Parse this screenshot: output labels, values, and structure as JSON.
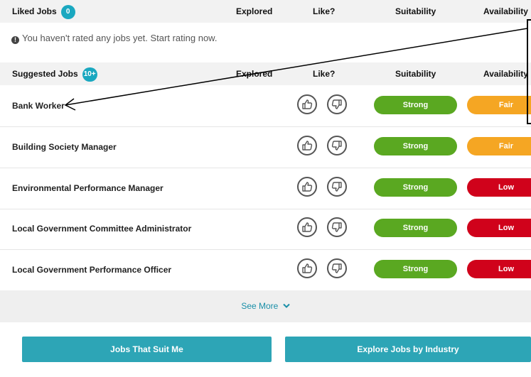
{
  "liked": {
    "title": "Liked Jobs",
    "count": "0",
    "col_explored": "Explored",
    "col_like": "Like?",
    "col_suitability": "Suitability",
    "col_availability": "Availability",
    "empty_message": "You haven't rated any jobs yet. Start rating now."
  },
  "suggested": {
    "title": "Suggested Jobs",
    "count": "10+",
    "col_explored": "Explored",
    "col_like": "Like?",
    "col_suitability": "Suitability",
    "col_availability": "Availability",
    "rows": [
      {
        "title": "Bank Worker",
        "suitability": "Strong",
        "availability": "Fair"
      },
      {
        "title": "Building Society Manager",
        "suitability": "Strong",
        "availability": "Fair"
      },
      {
        "title": "Environmental Performance Manager",
        "suitability": "Strong",
        "availability": "Low"
      },
      {
        "title": "Local Government Committee Administrator",
        "suitability": "Strong",
        "availability": "Low"
      },
      {
        "title": "Local Government Performance Officer",
        "suitability": "Strong",
        "availability": "Low"
      }
    ]
  },
  "see_more": {
    "label": "See More",
    "icon": "chevron-down-icon"
  },
  "buttons": {
    "jobs_that_suit": "Jobs That Suit Me",
    "explore_by_industry": "Explore Jobs by Industry"
  },
  "colors": {
    "strong": "#5aa821",
    "fair": "#f5a623",
    "low": "#d0021b",
    "accent": "#2da5b6",
    "badge": "#1aa8c0"
  }
}
